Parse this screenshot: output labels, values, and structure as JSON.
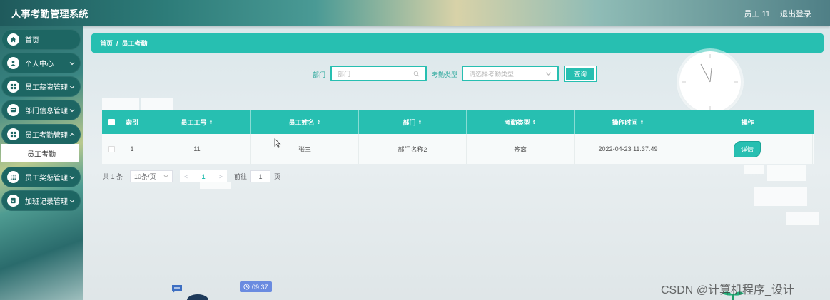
{
  "header": {
    "title": "人事考勤管理系统",
    "user": "员工 11",
    "logout": "退出登录"
  },
  "sidebar": {
    "items": [
      {
        "label": "首页",
        "icon": "home-icon",
        "has_chevron": false
      },
      {
        "label": "个人中心",
        "icon": "user-icon",
        "has_chevron": true
      },
      {
        "label": "员工薪资管理",
        "icon": "grid-icon",
        "has_chevron": true
      },
      {
        "label": "部门信息管理",
        "icon": "card-icon",
        "has_chevron": true
      },
      {
        "label": "员工考勤管理",
        "icon": "grid-icon",
        "has_chevron": true
      },
      {
        "label": "员工奖惩管理",
        "icon": "apps-icon",
        "has_chevron": true
      },
      {
        "label": "加班记录管理",
        "icon": "checklist-icon",
        "has_chevron": true
      }
    ],
    "active_sub": "员工考勤"
  },
  "breadcrumb": {
    "home": "首页",
    "separator": "/",
    "current": "员工考勤"
  },
  "search": {
    "dept_label": "部门",
    "dept_placeholder": "部门",
    "type_label": "考勤类型",
    "type_placeholder": "请选择考勤类型",
    "button": "查询"
  },
  "table": {
    "headers": {
      "index": "索引",
      "emp_no": "员工工号",
      "emp_name": "员工姓名",
      "dept": "部门",
      "type": "考勤类型",
      "time": "操作时间",
      "action": "操作"
    },
    "rows": [
      {
        "index": "1",
        "emp_no": "11",
        "emp_name": "张三",
        "dept": "部门名称2",
        "type": "签离",
        "time": "2022-04-23 11:37:49",
        "action": "详情"
      }
    ]
  },
  "pagination": {
    "total": "共 1 条",
    "page_size": "10条/页",
    "prev": "<",
    "current": "1",
    "next": ">",
    "goto_label": "前往",
    "goto_value": "1",
    "page_suffix": "页"
  },
  "widgets": {
    "time": "09:37",
    "watermark": "CSDN @计算机程序_设计"
  },
  "colors": {
    "accent": "#27bfb1",
    "nav_bg": "#1d6663"
  }
}
